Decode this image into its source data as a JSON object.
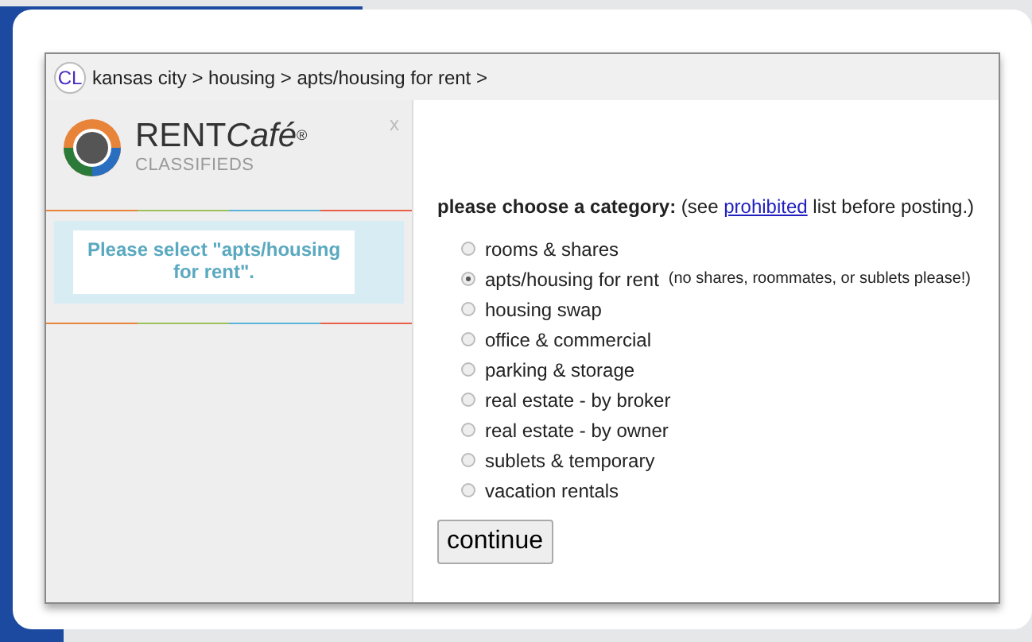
{
  "breadcrumb": {
    "badge": "CL",
    "path": "kansas city > housing > apts/housing for rent >"
  },
  "sidebar": {
    "logo": "RENT",
    "logo_script": "Café",
    "logo_mark": "®",
    "logo_subtitle": "CLASSIFIEDS",
    "close": "x",
    "notice": "Please select \"apts/housing for rent\"."
  },
  "form": {
    "heading": "please choose a category:",
    "note_before": "(see",
    "link": "prohibited",
    "note_after": "list before posting.)",
    "options": [
      {
        "label": "rooms & shares",
        "selected": false
      },
      {
        "label": "apts/housing for rent",
        "note": "(no shares, roommates, or sublets please!)",
        "selected": true
      },
      {
        "label": "housing swap",
        "selected": false
      },
      {
        "label": "office & commercial",
        "selected": false
      },
      {
        "label": "parking & storage",
        "selected": false
      },
      {
        "label": "real estate - by broker",
        "selected": false
      },
      {
        "label": "real estate - by owner",
        "selected": false
      },
      {
        "label": "sublets & temporary",
        "selected": false
      },
      {
        "label": "vacation rentals",
        "selected": false
      }
    ],
    "button": "continue"
  }
}
